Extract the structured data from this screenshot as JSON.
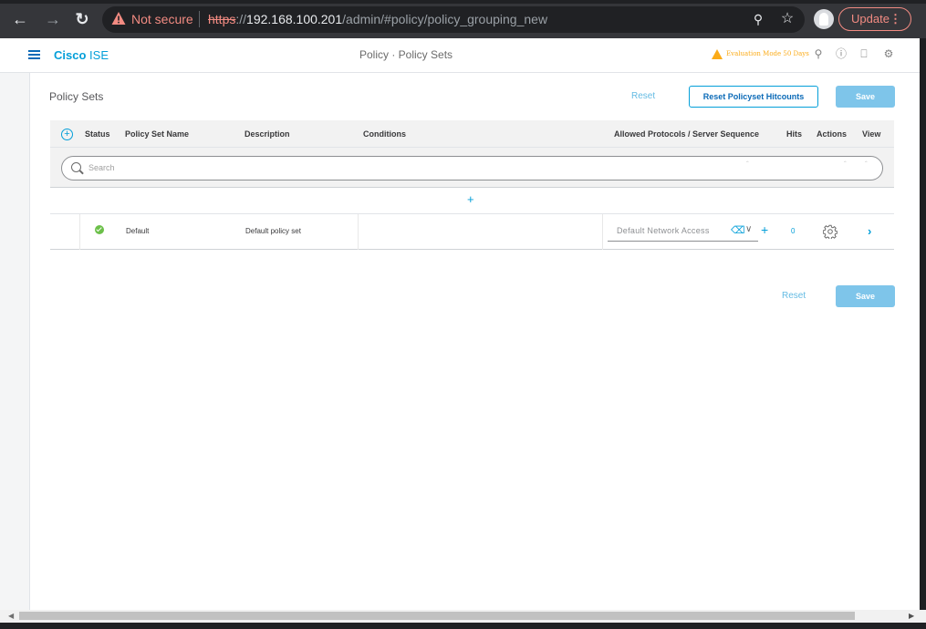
{
  "browser": {
    "security_label": "Not secure",
    "url_scheme": "https",
    "url_sep": "://",
    "url_host": "192.168.100.201",
    "url_path": "/admin/#policy/policy_grouping_new",
    "update_label": "Update",
    "warn_color": "#f28b82"
  },
  "header": {
    "brand_bold": "Cisco",
    "brand_light": "ISE",
    "title": "Policy · Policy Sets",
    "eval_text": "Evaluation Mode 50 Days",
    "brand_color": "#049fd9"
  },
  "page": {
    "title": "Policy Sets",
    "reset_label": "Reset",
    "reset_hitcounts_label": "Reset Policyset Hitcounts",
    "save_label": "Save"
  },
  "table": {
    "columns": [
      "Status",
      "Policy Set Name",
      "Description",
      "Conditions",
      "Allowed Protocols / Server Sequence",
      "Hits",
      "Actions",
      "View"
    ],
    "search_placeholder": "Search",
    "add_symbol": "+",
    "rows": [
      {
        "status": "enabled",
        "name": "Default",
        "description": "Default policy set",
        "conditions": "",
        "allowed_protocols": "Default Network Access",
        "hits": "0"
      }
    ]
  },
  "footer": {
    "reset_label": "Reset",
    "save_label": "Save"
  }
}
